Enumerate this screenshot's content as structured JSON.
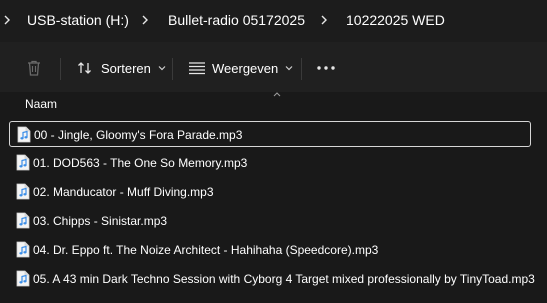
{
  "breadcrumb": {
    "items": [
      "USB-station (H:)",
      "Bullet-radio 05172025",
      "10222025 WED"
    ]
  },
  "toolbar": {
    "delete_icon": "trash-icon",
    "sort_label": "Sorteren",
    "view_label": "Weergeven",
    "more_icon": "ellipsis-icon"
  },
  "header": {
    "name_column": "Naam"
  },
  "files": [
    {
      "name": "00 - Jingle, Gloomy's Fora Parade.mp3",
      "selected": true
    },
    {
      "name": "01. DOD563 - The One So Memory.mp3",
      "selected": false
    },
    {
      "name": "02. Manducator - Muff Diving.mp3",
      "selected": false
    },
    {
      "name": "03. Chipps - Sinistar.mp3",
      "selected": false
    },
    {
      "name": "04. Dr. Eppo ft. The Noize Architect - Hahihaha (Speedcore).mp3",
      "selected": false
    },
    {
      "name": "05. A 43 min Dark Techno Session with Cyborg 4 Target mixed professionally by TinyToad.mp3",
      "selected": false
    }
  ],
  "colors": {
    "background": "#191919",
    "selection_border": "#d6d6d6",
    "icon_accent": "#3b8ee8"
  }
}
